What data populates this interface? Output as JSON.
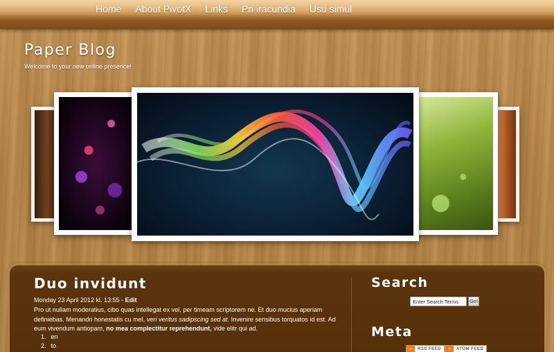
{
  "nav": {
    "items": [
      "Home",
      "About PivotX",
      "Links",
      "Pri iracundia",
      "Usu simul"
    ]
  },
  "header": {
    "title": "Paper Blog",
    "tagline": "Welcome to your new online presence!"
  },
  "post": {
    "title": "Duo invidunt",
    "meta_date": "Monday 23 April 2012 kl. 13:55 - ",
    "meta_edit": "Edit",
    "body_part1": "Pro ut nullam moderatius, cibo quas intellegat ex vel, per timeam scriptorem ne. Et duo mucius aperiam definiebas. Menandri honestatis cu mel, ",
    "body_italic": "veri veritus sadipscing sed at.",
    "body_part2": " Invenire sensibus torquatos id est. Ad eum vivendum antiopam, ",
    "body_bold": "no mea complectitur reprehendunt,",
    "body_part3": " vide elitr qui ad.",
    "list": [
      {
        "num": "1.",
        "text": "en"
      },
      {
        "num": "2.",
        "text": "to"
      }
    ]
  },
  "sidebar": {
    "search_heading": "Search",
    "search_placeholder": "Enter Search Terms",
    "search_button": "Go!",
    "meta_heading": "Meta",
    "feeds": [
      {
        "icon": "rss-icon",
        "label": "RSS FEED"
      },
      {
        "icon": "atom-icon",
        "label": "ATOM FEED"
      }
    ]
  },
  "colors": {
    "nav_bar": "#c8914f",
    "panel": "#56300a",
    "text": "#ffffff"
  }
}
